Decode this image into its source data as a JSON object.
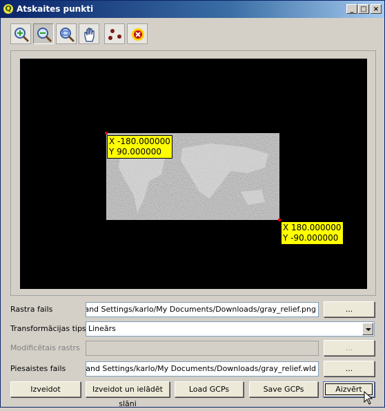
{
  "window": {
    "title": "Atskaites punkti",
    "app_icon": "qgis-icon",
    "controls": {
      "minimize": "_",
      "maximize": "□",
      "close": "×"
    }
  },
  "toolbar": {
    "tools": [
      {
        "name": "zoom-in-icon"
      },
      {
        "name": "zoom-out-icon",
        "active": true
      },
      {
        "name": "zoom-full-icon"
      },
      {
        "name": "pan-icon"
      },
      {
        "name": "add-point-icon"
      },
      {
        "name": "delete-point-icon"
      }
    ]
  },
  "canvas": {
    "background": "#000000",
    "gcp_points": [
      {
        "x_label": "X -180.000000",
        "y_label": "Y 90.000000"
      },
      {
        "x_label": "X 180.000000",
        "y_label": "Y -90.000000"
      }
    ],
    "label_color": "#ffff00",
    "marker_color": "#d00000"
  },
  "form": {
    "raster_file": {
      "label": "Rastra fails",
      "value": "C:/Documents and Settings/karlo/My Documents/Downloads/gray_relief.png",
      "browse": "..."
    },
    "transform_type": {
      "label": "Transformācijas tips",
      "value": "Lineārs"
    },
    "modified_raster": {
      "label": "Modificētais rastrs",
      "value": "",
      "browse": "..."
    },
    "world_file": {
      "label": "Piesaistes fails",
      "value": "C:/Documents and Settings/karlo/My Documents/Downloads/gray_relief.wld",
      "browse": "..."
    }
  },
  "buttons": {
    "create": "Izveidot",
    "create_and_load": "Izveidot un ielādēt slāni",
    "load_gcps": "Load GCPs",
    "save_gcps": "Save GCPs",
    "close": "Aizvērt"
  }
}
